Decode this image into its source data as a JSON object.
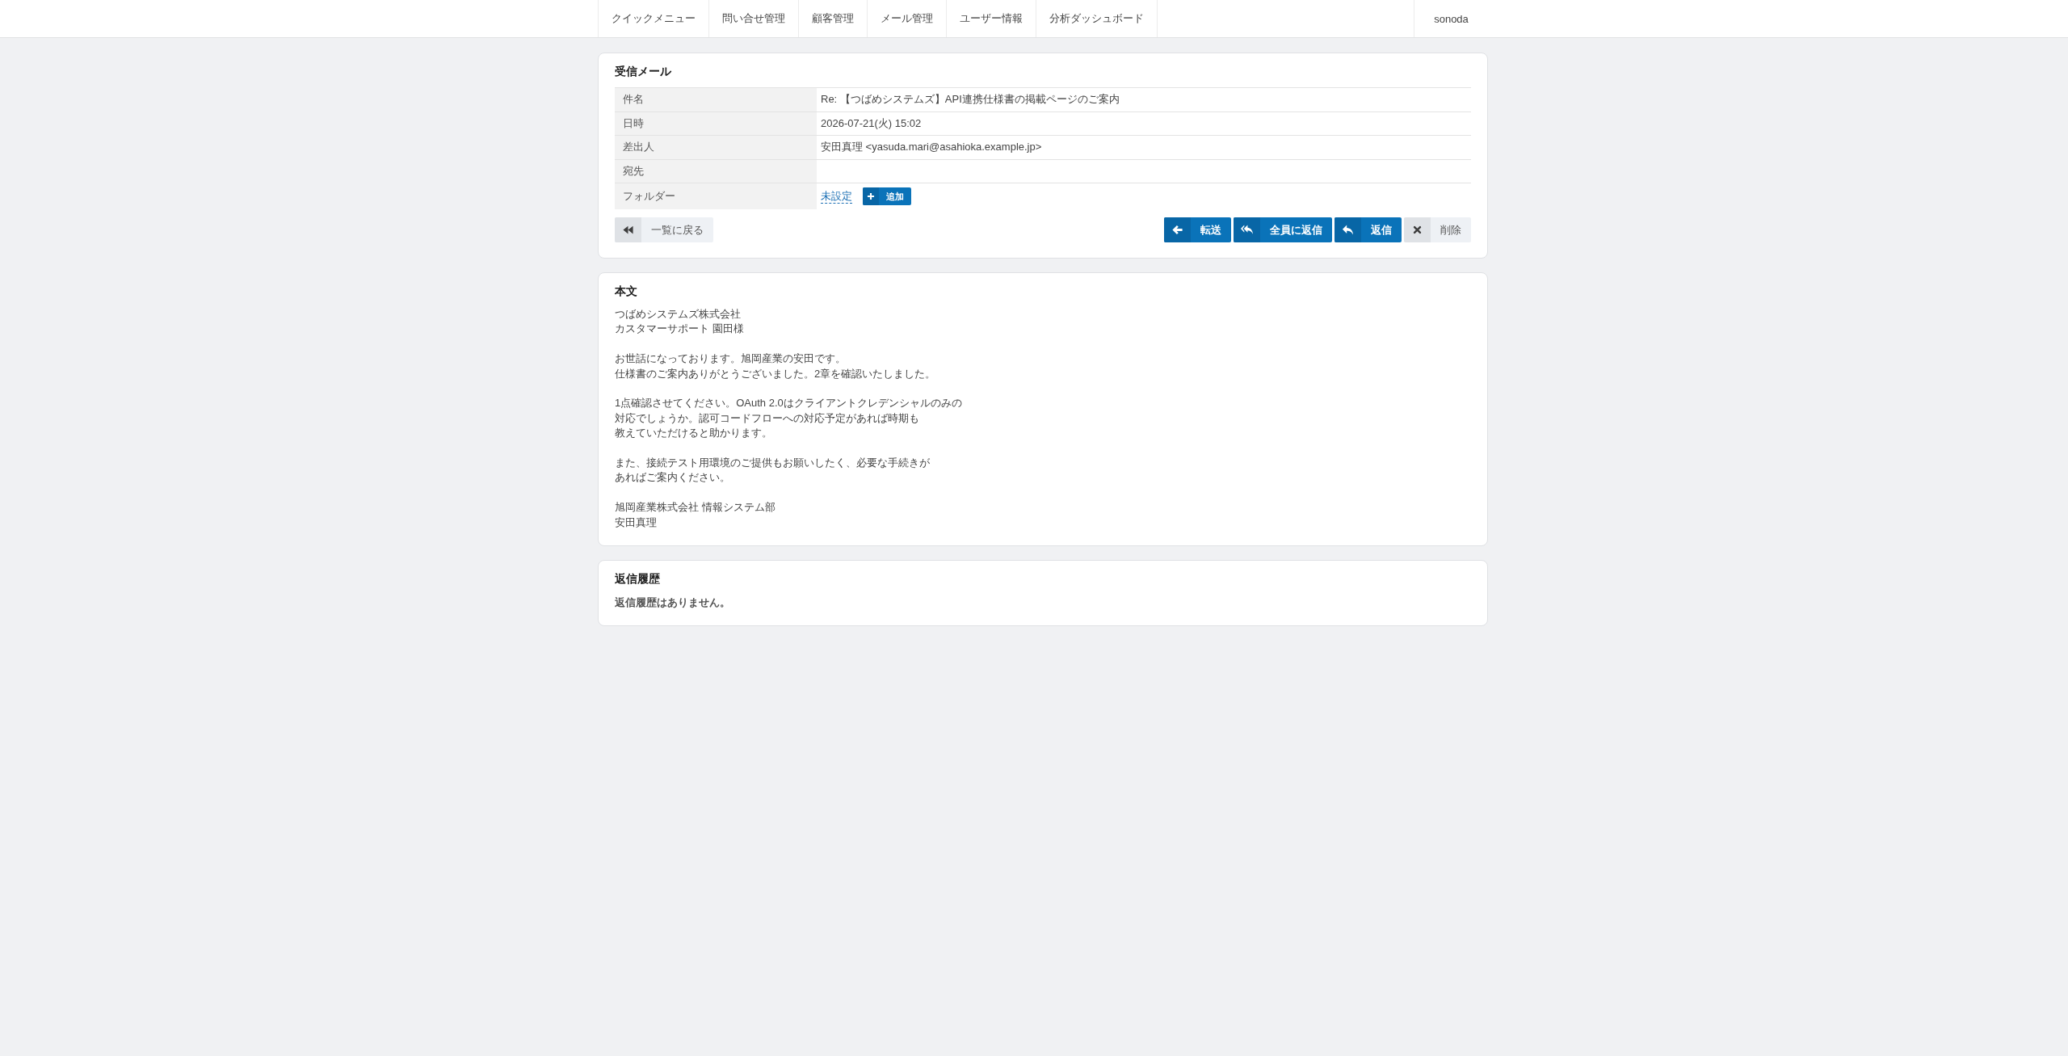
{
  "nav": {
    "menu": [
      {
        "label": "クイックメニュー"
      },
      {
        "label": "問い合せ管理"
      },
      {
        "label": "顧客管理"
      },
      {
        "label": "メール管理"
      },
      {
        "label": "ユーザー情報"
      },
      {
        "label": "分析ダッシュボード"
      }
    ],
    "user": "sonoda"
  },
  "mail_card": {
    "title": "受信メール",
    "fields": [
      {
        "kind": "text",
        "label": "件名",
        "value": "Re: 【つばめシステムズ】API連携仕様書の掲載ページのご案内"
      },
      {
        "kind": "text",
        "label": "日時",
        "value": "2026-07-21(火) 15:02"
      },
      {
        "kind": "text",
        "label": "差出人",
        "value": "安田真理 <yasuda.mari@asahioka.example.jp>"
      },
      {
        "kind": "text",
        "label": "宛先"
      },
      {
        "kind": "folder",
        "label": "フォルダー",
        "link": "未設定",
        "button": "追加"
      }
    ],
    "back_button": {
      "label": "一覧に戻る"
    },
    "actions": [
      {
        "kind": "forward",
        "label": "転送"
      },
      {
        "kind": "reply_all",
        "label": "全員に返信"
      },
      {
        "kind": "reply",
        "label": "返信"
      },
      {
        "kind": "delete",
        "label": "削除"
      }
    ]
  },
  "body_card": {
    "title": "本文",
    "paragraphs": [
      {
        "lines": [
          "つばめシステムズ株式会社",
          "カスタマーサポート 園田様"
        ]
      },
      {
        "lines": [
          "お世話になっております。旭岡産業の安田です。",
          "仕様書のご案内ありがとうございました。2章を確認いたしました。"
        ]
      },
      {
        "lines": [
          "1点確認させてください。OAuth 2.0はクライアントクレデンシャルのみの",
          "対応でしょうか。認可コードフローへの対応予定があれば時期も",
          "教えていただけると助かります。"
        ]
      },
      {
        "lines": [
          "また、接続テスト用環境のご提供もお願いしたく、必要な手続きが",
          "あればご案内ください。"
        ]
      },
      {
        "lines": [
          "旭岡産業株式会社 情報システム部",
          "安田真理"
        ]
      }
    ]
  },
  "history_card": {
    "title": "返信履歴",
    "empty_message": "返信履歴はありません。"
  }
}
